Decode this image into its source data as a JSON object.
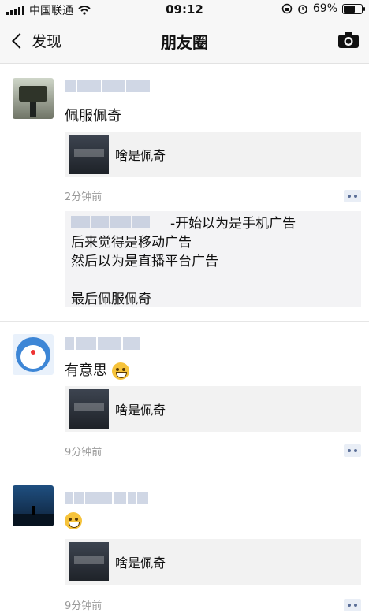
{
  "status_bar": {
    "carrier": "中国联通",
    "time": "09:12",
    "battery_text": "69%",
    "battery_level": 0.69
  },
  "nav": {
    "back_label": "发现",
    "title": "朋友圈",
    "camera_icon": "camera-icon"
  },
  "posts": [
    {
      "text": "佩服佩奇",
      "link_title": "啥是佩奇",
      "time": "2分钟前",
      "comment_lines": [
        "-开始以为是手机广告",
        "后来觉得是移动广告",
        "然后以为是直播平台广告",
        "",
        "最后佩服佩奇"
      ]
    },
    {
      "text": "有意思",
      "link_title": "啥是佩奇",
      "time": "9分钟前"
    },
    {
      "text": "",
      "link_title": "啥是佩奇",
      "time": "9分钟前"
    }
  ]
}
